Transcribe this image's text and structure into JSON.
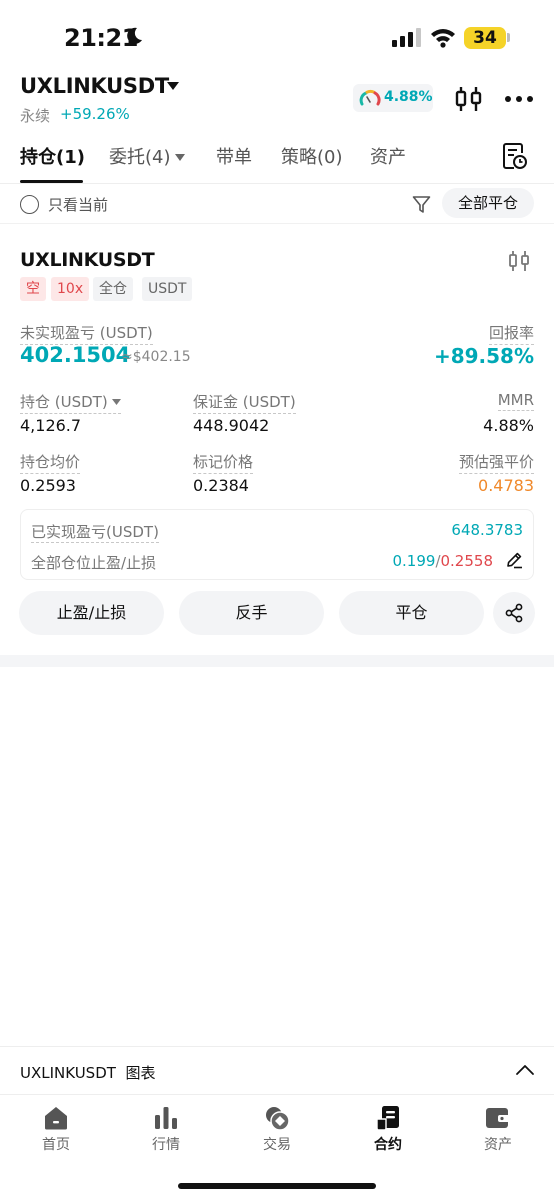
{
  "status_bar": {
    "time": "21:21",
    "battery": "34"
  },
  "header": {
    "pair": "UXLINKUSDT",
    "contract_type": "永续",
    "change": "+59.26%",
    "mmr_chip": "4.88%"
  },
  "tabs": [
    {
      "label": "持仓(1)"
    },
    {
      "label": "委托(4)"
    },
    {
      "label": "带单"
    },
    {
      "label": "策略(0)"
    },
    {
      "label": "资产"
    }
  ],
  "filter": {
    "only_current": "只看当前",
    "close_all": "全部平仓"
  },
  "position": {
    "symbol": "UXLINKUSDT",
    "tags": {
      "side": "空",
      "leverage": "10x",
      "margin_mode": "全仓",
      "settle": "USDT"
    },
    "unrealized_pnl_label": "未实现盈亏 (USDT)",
    "unrealized_pnl": "402.1504",
    "unrealized_pnl_usd": "≈$402.15",
    "roe_label": "回报率",
    "roe": "+89.58%",
    "size_label": "持仓 (USDT)",
    "size": "4,126.7",
    "margin_label": "保证金 (USDT)",
    "margin": "448.9042",
    "mmr_label": "MMR",
    "mmr": "4.88%",
    "entry_label": "持仓均价",
    "entry": "0.2593",
    "mark_label": "标记价格",
    "mark": "0.2384",
    "liq_label": "预估强平价",
    "liq": "0.4783",
    "realized_label": "已实现盈亏(USDT)",
    "realized": "648.3783",
    "tpsl_label": "全部仓位止盈/止损",
    "tp": "0.199",
    "sl": "0.2558"
  },
  "actions": {
    "tpsl": "止盈/止损",
    "reverse": "反手",
    "close": "平仓"
  },
  "chart_bar": {
    "label": "UXLINKUSDT  图表"
  },
  "nav": [
    {
      "label": "首页"
    },
    {
      "label": "行情"
    },
    {
      "label": "交易"
    },
    {
      "label": "合约"
    },
    {
      "label": "资产"
    }
  ],
  "colors": {
    "accent": "#00a8b5",
    "loss": "#e0474c",
    "warning": "#f0892b",
    "battery": "#f5d328"
  }
}
